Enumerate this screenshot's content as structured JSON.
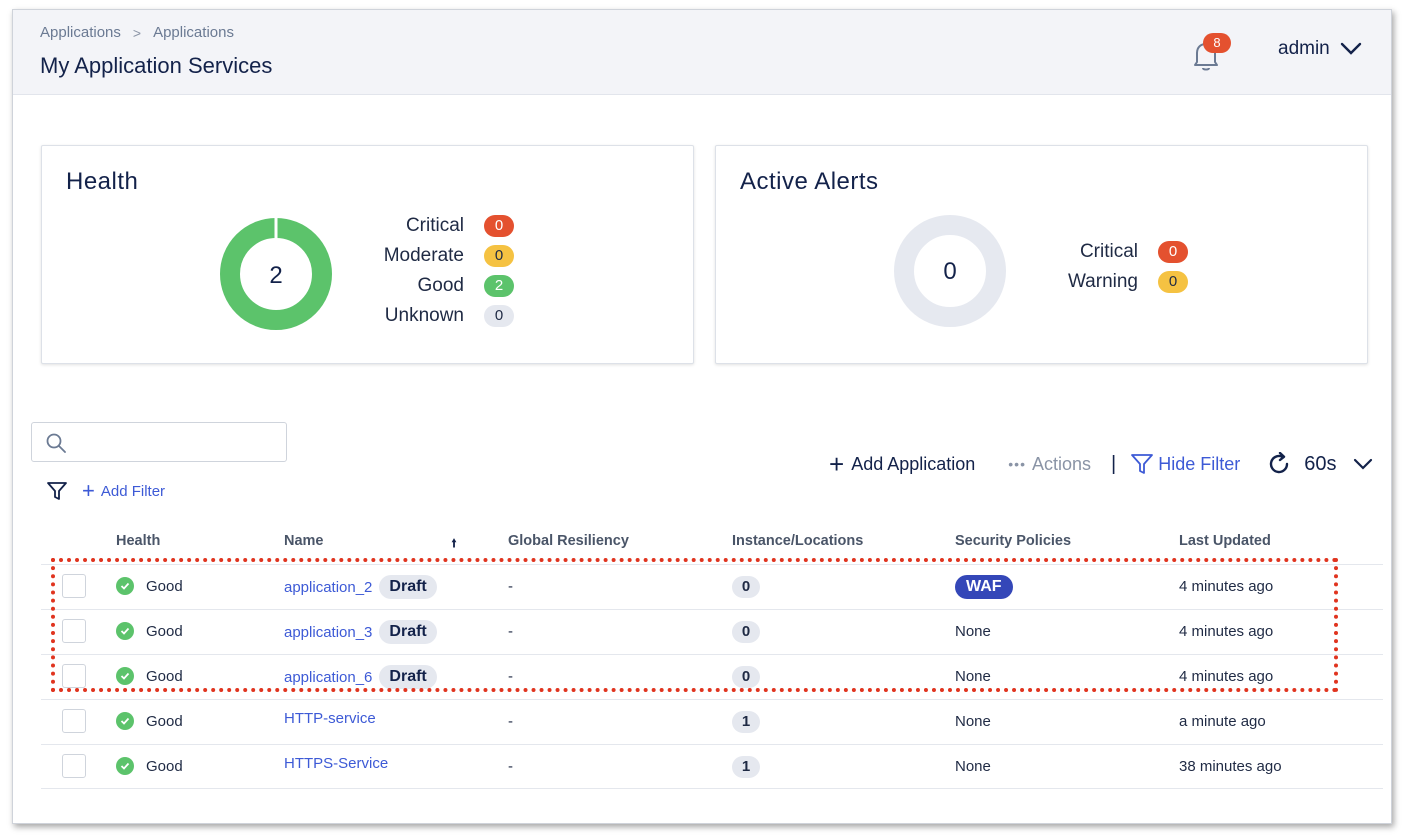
{
  "header": {
    "breadcrumb": [
      "Applications",
      "Applications"
    ],
    "breadcrumb_separator": ">",
    "title": "My Application Services",
    "notification_count": "8",
    "user": "admin"
  },
  "health_card": {
    "title": "Health",
    "total": "2",
    "legend": [
      {
        "label": "Critical",
        "value": "0",
        "color": "#e4512f"
      },
      {
        "label": "Moderate",
        "value": "0",
        "color": "#f5c242"
      },
      {
        "label": "Good",
        "value": "2",
        "color": "#5cc36b"
      },
      {
        "label": "Unknown",
        "value": "0",
        "color": "#e5e8ef"
      }
    ]
  },
  "alerts_card": {
    "title": "Active Alerts",
    "total": "0",
    "legend": [
      {
        "label": "Critical",
        "value": "0",
        "color": "#e4512f"
      },
      {
        "label": "Warning",
        "value": "0",
        "color": "#f5c242"
      }
    ]
  },
  "toolbar": {
    "search_placeholder": "",
    "add_filter": "Add Filter",
    "add_application": "Add Application",
    "actions": "Actions",
    "hide_filter": "Hide Filter",
    "refresh_interval": "60s"
  },
  "table": {
    "columns": [
      "Health",
      "Name",
      "Global Resiliency",
      "Instance/Locations",
      "Security Policies",
      "Last Updated"
    ],
    "rows": [
      {
        "health": "Good",
        "name": "application_2",
        "status": "Draft",
        "resiliency": "-",
        "instances": "0",
        "policy": "WAF",
        "updated": "4 minutes ago"
      },
      {
        "health": "Good",
        "name": "application_3",
        "status": "Draft",
        "resiliency": "-",
        "instances": "0",
        "policy": "None",
        "updated": "4 minutes ago"
      },
      {
        "health": "Good",
        "name": "application_6",
        "status": "Draft",
        "resiliency": "-",
        "instances": "0",
        "policy": "None",
        "updated": "4 minutes ago"
      },
      {
        "health": "Good",
        "name": "HTTP-service",
        "status": "",
        "resiliency": "-",
        "instances": "1",
        "policy": "None",
        "updated": "a minute ago"
      },
      {
        "health": "Good",
        "name": "HTTPS-Service",
        "status": "",
        "resiliency": "-",
        "instances": "1",
        "policy": "None",
        "updated": "38 minutes ago"
      }
    ]
  },
  "colors": {
    "accent": "#3d5ad6",
    "good": "#5cc36b",
    "critical": "#e4512f",
    "warning": "#f5c242",
    "waf": "#3447b8",
    "highlight": "#e0341f"
  }
}
